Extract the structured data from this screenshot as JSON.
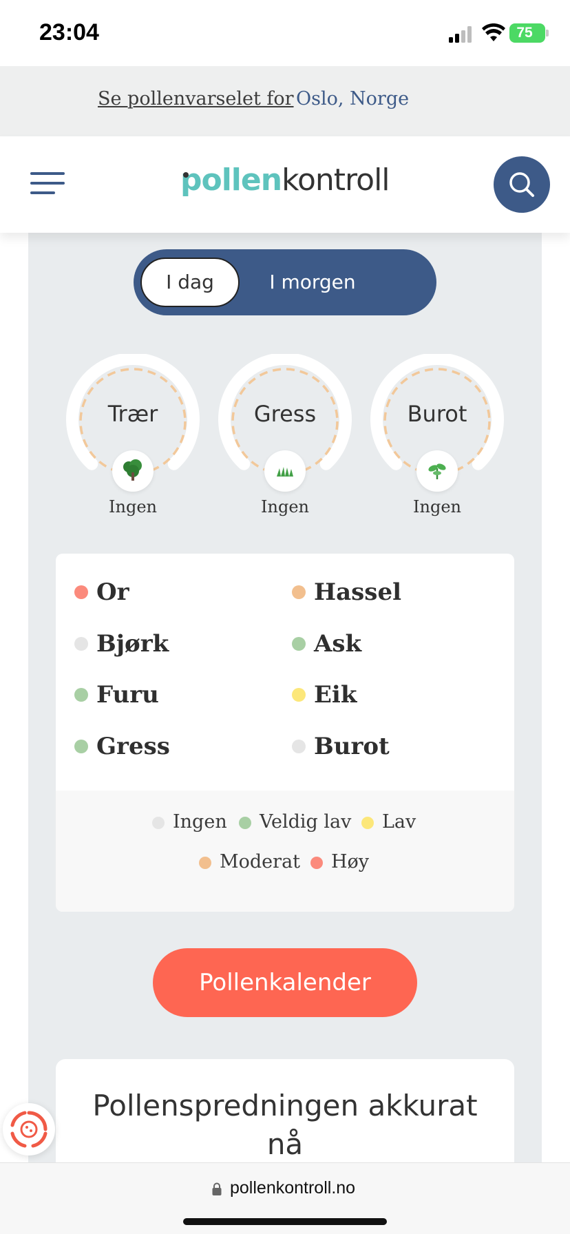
{
  "status_bar": {
    "time": "23:04",
    "battery": "75"
  },
  "location_banner": {
    "prefix": "Se pollenvarselet for",
    "location": "Oslo, Norge"
  },
  "header": {
    "logo_part1": "pollen",
    "logo_part2": "kontroll",
    "menu_icon": "hamburger-icon",
    "search_icon": "search-icon"
  },
  "day_toggle": {
    "today": "I dag",
    "tomorrow": "I morgen",
    "selected": "I dag"
  },
  "gauges": [
    {
      "label": "Trær",
      "level": "Ingen",
      "icon": "tree-icon"
    },
    {
      "label": "Gress",
      "level": "Ingen",
      "icon": "grass-icon"
    },
    {
      "label": "Burot",
      "level": "Ingen",
      "icon": "weed-icon"
    }
  ],
  "plants": [
    {
      "name": "Or",
      "color": "#fb8a7c"
    },
    {
      "name": "Hassel",
      "color": "#f2bf8e"
    },
    {
      "name": "Bjørk",
      "color": "#e5e5e5"
    },
    {
      "name": "Ask",
      "color": "#a8cfa4"
    },
    {
      "name": "Furu",
      "color": "#a8cfa4"
    },
    {
      "name": "Eik",
      "color": "#fce77a"
    },
    {
      "name": "Gress",
      "color": "#a8cfa4"
    },
    {
      "name": "Burot",
      "color": "#e5e5e5"
    }
  ],
  "scale": [
    {
      "name": "Ingen",
      "color": "#e5e5e5"
    },
    {
      "name": "Veldig lav",
      "color": "#a8cfa4"
    },
    {
      "name": "Lav",
      "color": "#fce77a"
    },
    {
      "name": "Moderat",
      "color": "#f2bf8e"
    },
    {
      "name": "Høy",
      "color": "#fb8a7c"
    }
  ],
  "calendar_button": "Pollenkalender",
  "spread_title": "Pollenspredningen akkurat nå",
  "url": "pollenkontroll.no",
  "colors": {
    "brand_blue": "#3d5a88",
    "brand_teal": "#5ec3bd",
    "accent_red": "#fe6652",
    "gauge_dash": "#f2c89a"
  }
}
